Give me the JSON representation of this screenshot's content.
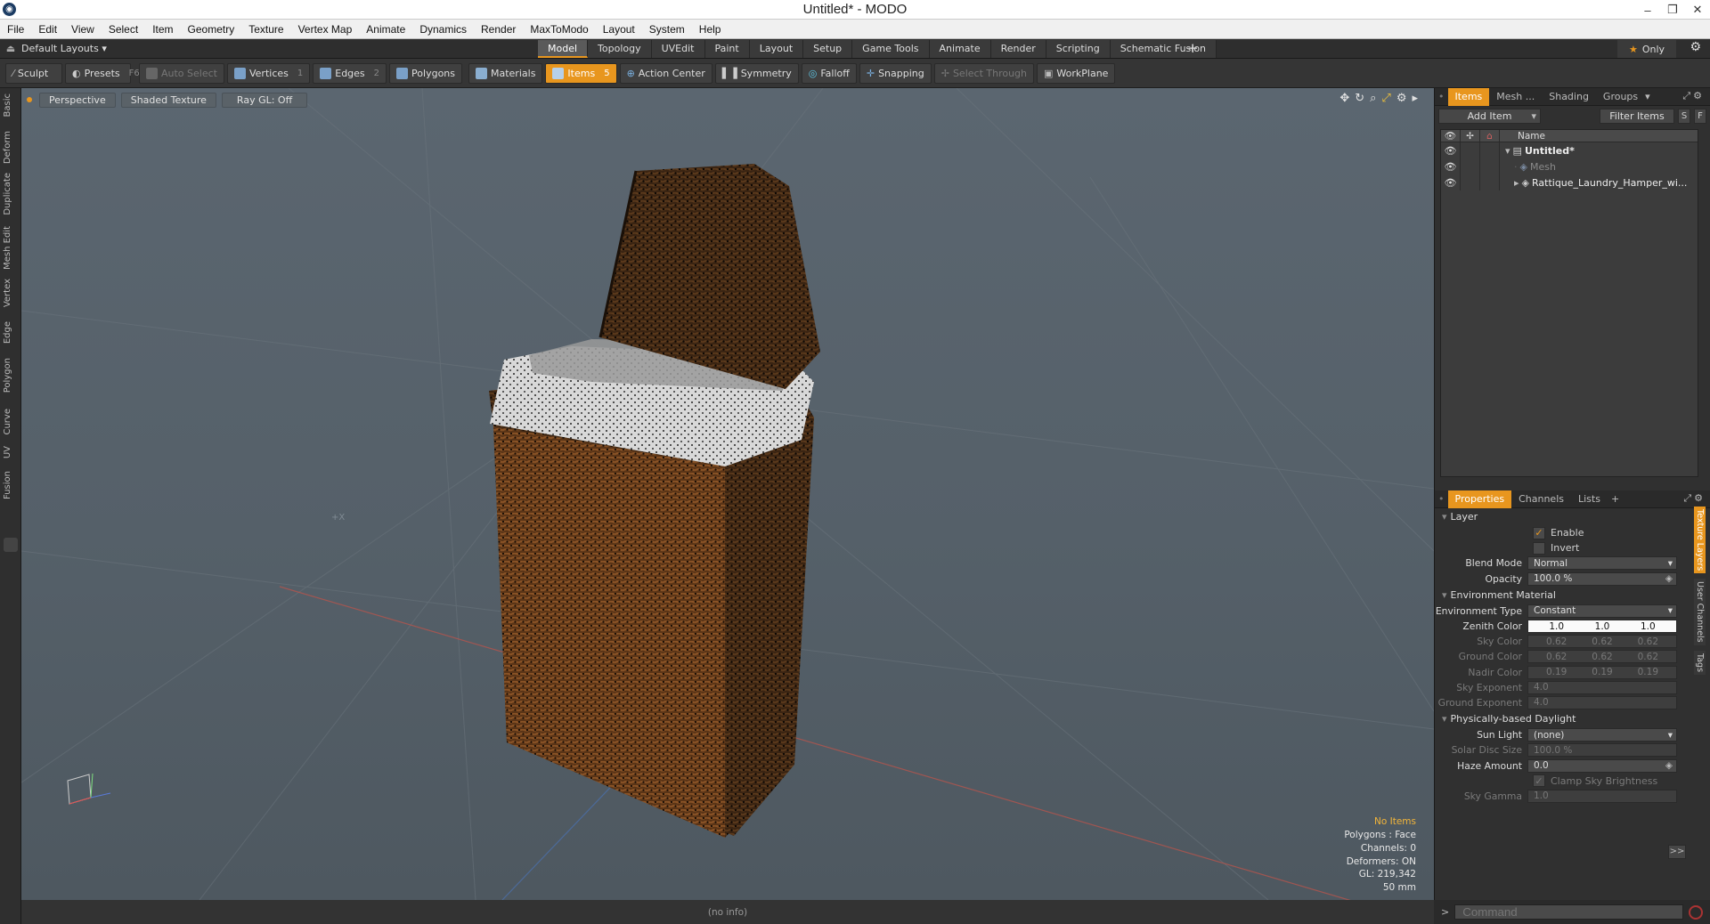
{
  "window": {
    "title": "Untitled* - MODO",
    "app_icon": "modo-logo-icon"
  },
  "menubar": [
    "File",
    "Edit",
    "View",
    "Select",
    "Item",
    "Geometry",
    "Texture",
    "Vertex Map",
    "Animate",
    "Dynamics",
    "Render",
    "MaxToModo",
    "Layout",
    "System",
    "Help"
  ],
  "layoutbar": {
    "layout_name": "Default Layouts",
    "tabs": [
      "Model",
      "Topology",
      "UVEdit",
      "Paint",
      "Layout",
      "Setup",
      "Game Tools",
      "Animate",
      "Render",
      "Scripting",
      "Schematic Fusion"
    ],
    "active_tab": "Model",
    "only_label": "Only"
  },
  "toolbar": {
    "sculpt": "Sculpt",
    "presets": "Presets",
    "presets_key": "F6",
    "auto_select": "Auto Select",
    "vertices": "Vertices",
    "vertices_key": "1",
    "edges": "Edges",
    "edges_key": "2",
    "polygons": "Polygons",
    "materials": "Materials",
    "items": "Items",
    "items_key": "5",
    "action_center": "Action Center",
    "symmetry": "Symmetry",
    "falloff": "Falloff",
    "snapping": "Snapping",
    "select_through": "Select Through",
    "workplane": "WorkPlane"
  },
  "left_tabs": [
    "Basic",
    "Deform",
    "Duplicate",
    "Mesh Edit",
    "Vertex",
    "Edge",
    "Polygon",
    "Curve",
    "UV",
    "Fusion"
  ],
  "viewport": {
    "view_mode": "Perspective",
    "shading": "Shaded Texture",
    "raygl": "Ray GL: Off",
    "axis_label": "+X",
    "info": {
      "selection": "No Items",
      "polygons": "Polygons : Face",
      "channels": "Channels: 0",
      "deformers": "Deformers: ON",
      "gl": "GL: 219,342",
      "focal": "50 mm"
    }
  },
  "status": "(no info)",
  "items_panel": {
    "tabs": [
      "Items",
      "Mesh ...",
      "Shading",
      "Groups"
    ],
    "active_tab": "Items",
    "add_item": "Add Item",
    "filter": "Filter Items",
    "btn_s": "S",
    "btn_f": "F",
    "name_header": "Name",
    "rows": [
      {
        "name": "Untitled*",
        "icon": "scene-icon"
      },
      {
        "name": "Mesh",
        "icon": "mesh-icon"
      },
      {
        "name": "Rattique_Laundry_Hamper_wi...",
        "icon": "mesh-icon"
      }
    ]
  },
  "properties_panel": {
    "tabs": [
      "Properties",
      "Channels",
      "Lists"
    ],
    "active_tab": "Properties",
    "layer_group": "Layer",
    "enable": "Enable",
    "invert": "Invert",
    "blend_mode_label": "Blend Mode",
    "blend_mode": "Normal",
    "opacity_label": "Opacity",
    "opacity": "100.0 %",
    "env_group": "Environment Material",
    "env_type_label": "Environment Type",
    "env_type": "Constant",
    "zenith_label": "Zenith Color",
    "zenith": [
      "1.0",
      "1.0",
      "1.0"
    ],
    "sky_label": "Sky Color",
    "sky": [
      "0.62",
      "0.62",
      "0.62"
    ],
    "ground_label": "Ground Color",
    "ground": [
      "0.62",
      "0.62",
      "0.62"
    ],
    "nadir_label": "Nadir Color",
    "nadir": [
      "0.19",
      "0.19",
      "0.19"
    ],
    "sky_exp_label": "Sky Exponent",
    "sky_exp": "4.0",
    "ground_exp_label": "Ground Exponent",
    "ground_exp": "4.0",
    "daylight_group": "Physically-based Daylight",
    "sun_light_label": "Sun Light",
    "sun_light": "(none)",
    "solar_disc_label": "Solar Disc Size",
    "solar_disc": "100.0 %",
    "haze_label": "Haze Amount",
    "haze": "0.0",
    "clamp": "Clamp Sky Brightness",
    "sky_gamma_label": "Sky Gamma",
    "sky_gamma": "1.0",
    "more": ">>"
  },
  "side_vtabs": [
    "Texture Layers",
    "User Channels",
    "Tags"
  ],
  "command": {
    "placeholder": "Command",
    "prompt": ">"
  },
  "colors": {
    "accent": "#e8961e",
    "viewport": "#5b6670"
  }
}
